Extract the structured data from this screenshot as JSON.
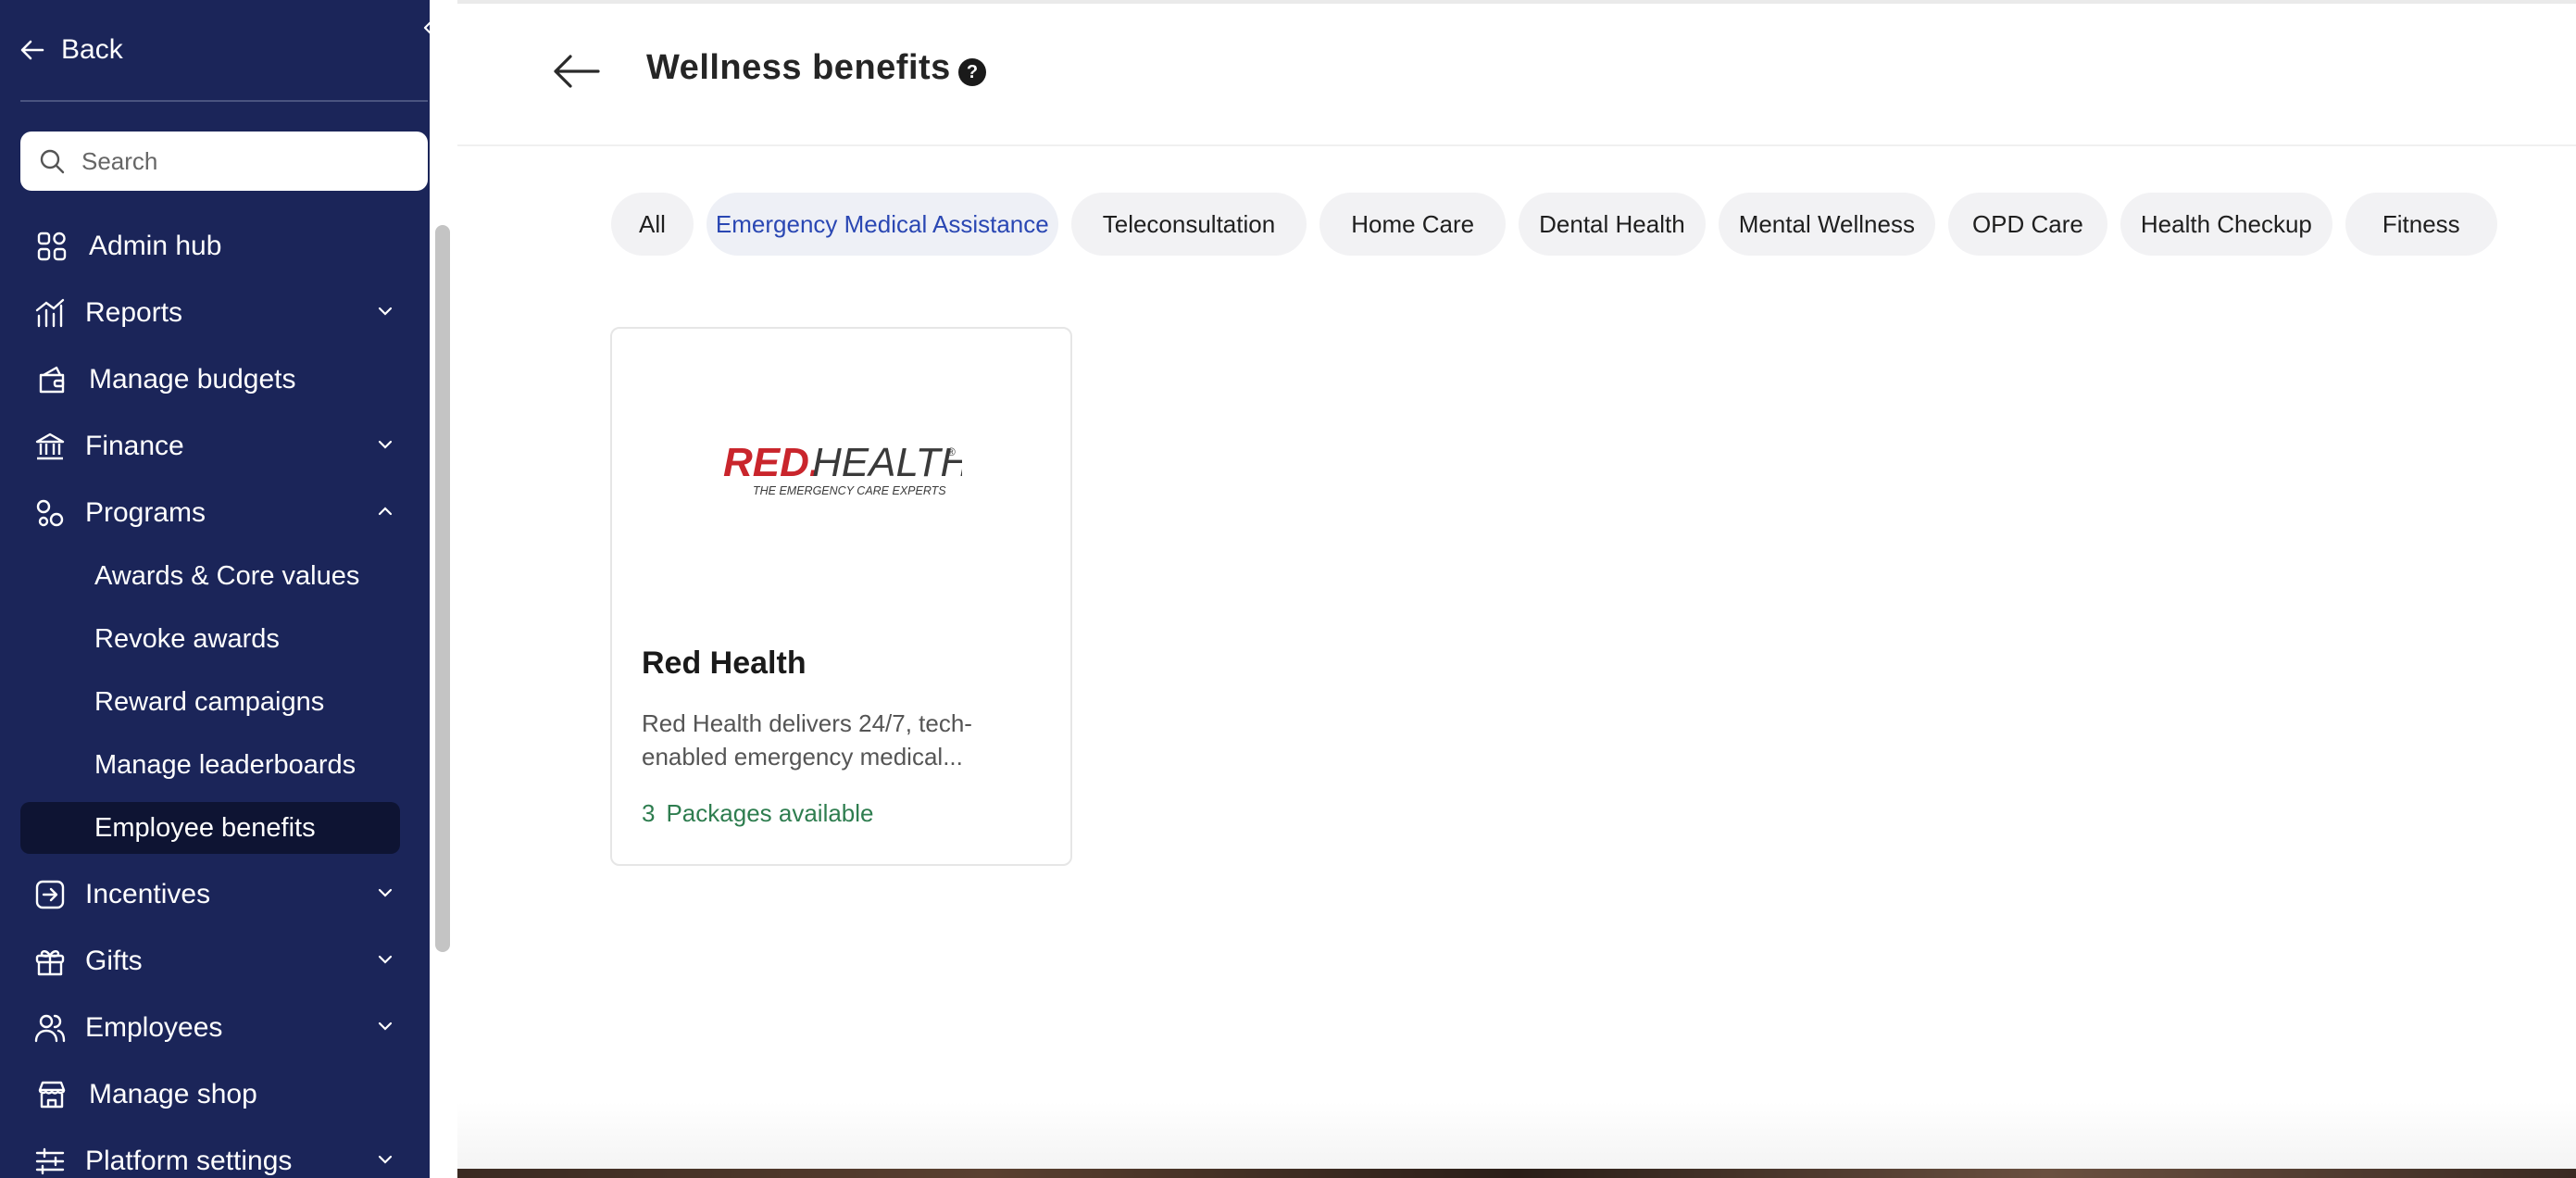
{
  "sidebar": {
    "back_label": "Back",
    "search_placeholder": "Search",
    "items": [
      {
        "label": "Admin hub",
        "icon": "grid-icon"
      },
      {
        "label": "Reports",
        "icon": "chart-icon"
      },
      {
        "label": "Manage budgets",
        "icon": "wallet-icon"
      },
      {
        "label": "Finance",
        "icon": "bank-icon"
      },
      {
        "label": "Programs",
        "icon": "shapes-icon"
      },
      {
        "label": "Incentives",
        "icon": "arrow-box-icon"
      },
      {
        "label": "Gifts",
        "icon": "gift-icon"
      },
      {
        "label": "Employees",
        "icon": "users-icon"
      },
      {
        "label": "Manage shop",
        "icon": "store-icon"
      },
      {
        "label": "Platform settings",
        "icon": "sliders-icon"
      }
    ],
    "program_subitems": [
      "Awards & Core values",
      "Revoke awards",
      "Reward campaigns",
      "Manage leaderboards",
      "Employee benefits"
    ],
    "active_subitem": "Employee benefits"
  },
  "header": {
    "title": "Wellness benefits",
    "help_glyph": "?"
  },
  "categories": [
    "All",
    "Emergency Medical Assistance",
    "Teleconsultation",
    "Home Care",
    "Dental Health",
    "Mental Wellness",
    "OPD Care",
    "Health Checkup",
    "Fitness"
  ],
  "active_category": "Emergency Medical Assistance",
  "cards": [
    {
      "name": "Red Health",
      "logo_main": "RED.",
      "logo_second": "HEALTH",
      "logo_mark": "®",
      "logo_tagline": "THE EMERGENCY CARE EXPERTS",
      "description": "Red Health delivers 24/7, tech-enabled emergency medical...",
      "packages_count": "3",
      "packages_label": "Packages available"
    }
  ],
  "colors": {
    "sidebar_bg": "#1b2559",
    "active_item_bg": "#0e1433",
    "active_chip_text": "#2a47b3",
    "packages_text": "#2e7d4f",
    "logo_red": "#c9252c"
  }
}
